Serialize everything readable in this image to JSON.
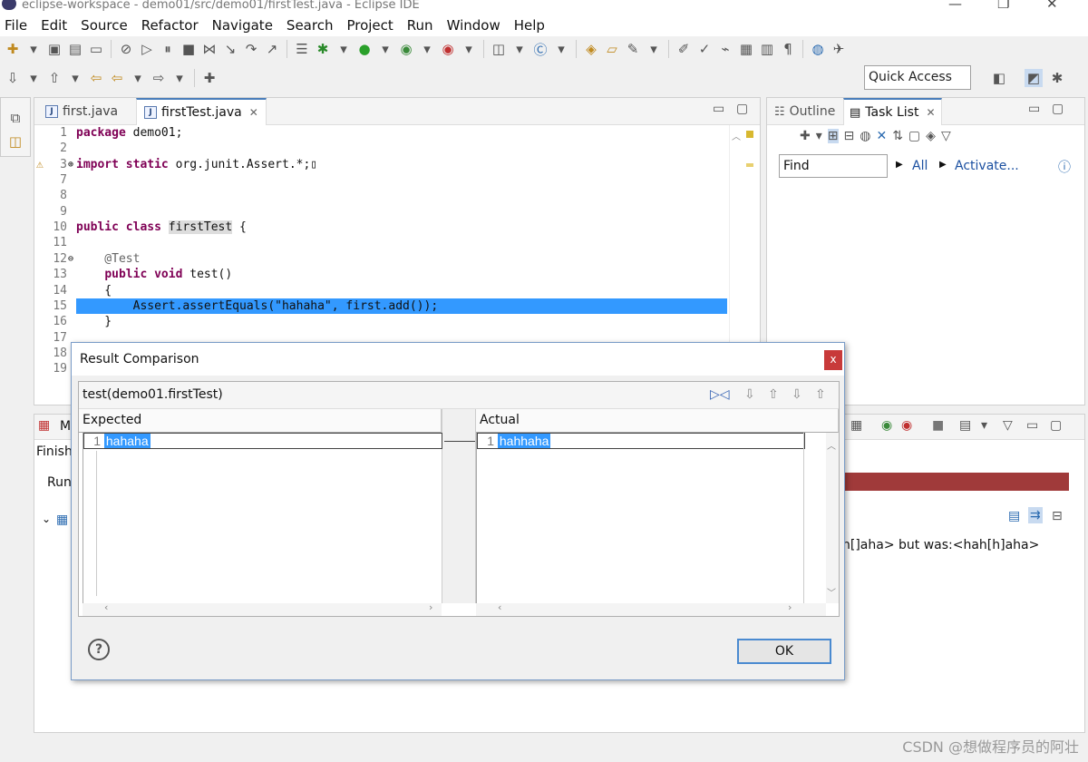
{
  "window": {
    "title": "eclipse-workspace - demo01/src/demo01/firstTest.java - Eclipse IDE"
  },
  "menu": [
    "File",
    "Edit",
    "Source",
    "Refactor",
    "Navigate",
    "Search",
    "Project",
    "Run",
    "Window",
    "Help"
  ],
  "quick_access": "Quick Access",
  "editor": {
    "tabs": [
      {
        "label": "first.java"
      },
      {
        "label": "firstTest.java"
      }
    ],
    "lines": [
      {
        "n": "1",
        "text": "package demo01;"
      },
      {
        "n": "2",
        "text": ""
      },
      {
        "n": "3",
        "text": "import static org.junit.Assert.*;"
      },
      {
        "n": "7",
        "text": ""
      },
      {
        "n": "8",
        "text": ""
      },
      {
        "n": "9",
        "text": ""
      },
      {
        "n": "10",
        "text": "public class firstTest {"
      },
      {
        "n": "11",
        "text": ""
      },
      {
        "n": "12",
        "text": "    @Test"
      },
      {
        "n": "13",
        "text": "    public void test()"
      },
      {
        "n": "14",
        "text": "    {"
      },
      {
        "n": "15",
        "text": "        Assert.assertEquals(\"hahaha\", first.add());"
      },
      {
        "n": "16",
        "text": "    }"
      },
      {
        "n": "17",
        "text": ""
      },
      {
        "n": "18",
        "text": ""
      },
      {
        "n": "19",
        "text": ""
      }
    ]
  },
  "outline": {
    "tabs": [
      "Outline",
      "Task List"
    ],
    "find_placeholder": "Find",
    "all_label": "All",
    "activate_label": "Activate..."
  },
  "junit": {
    "tab_initial": "M",
    "finished_label": "Finish",
    "runs_label": "Run",
    "failure_text": "h[]aha> but was:<hah[h]aha>"
  },
  "dialog": {
    "title": "Result Comparison",
    "header": "test(demo01.firstTest)",
    "expected_label": "Expected",
    "actual_label": "Actual",
    "expected_line_no": "1",
    "expected_value": "hahaha",
    "actual_line_no": "1",
    "actual_value": "hahhaha",
    "ok_label": "OK",
    "close_label": "x",
    "help_label": "?"
  },
  "watermark": "CSDN @想做程序员的阿壮"
}
